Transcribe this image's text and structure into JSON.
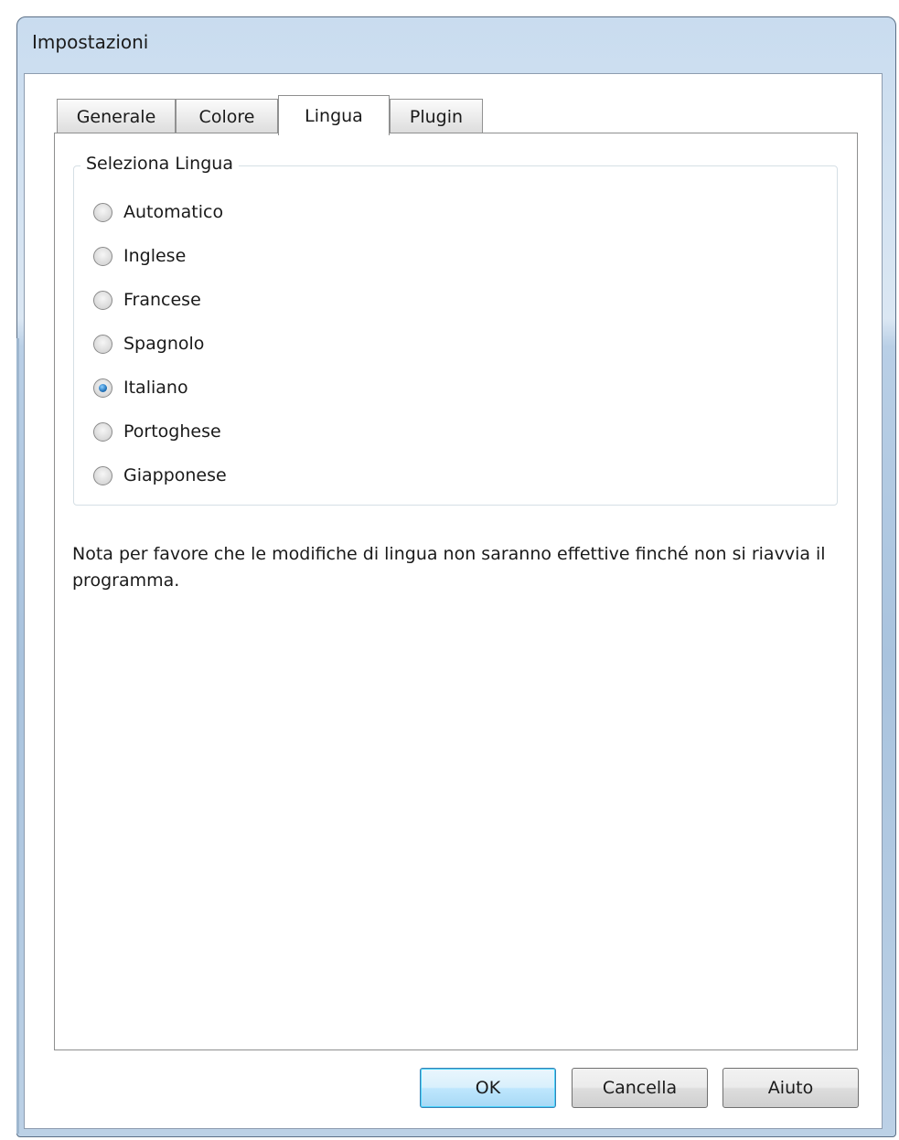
{
  "window": {
    "title": "Impostazioni"
  },
  "tabs": [
    {
      "label": "Generale",
      "active": false
    },
    {
      "label": "Colore",
      "active": false
    },
    {
      "label": "Lingua",
      "active": true
    },
    {
      "label": "Plugin",
      "active": false
    }
  ],
  "language_group": {
    "legend": "Seleziona Lingua",
    "options": [
      {
        "label": "Automatico",
        "checked": false
      },
      {
        "label": "Inglese",
        "checked": false
      },
      {
        "label": "Francese",
        "checked": false
      },
      {
        "label": "Spagnolo",
        "checked": false
      },
      {
        "label": "Italiano",
        "checked": true
      },
      {
        "label": "Portoghese",
        "checked": false
      },
      {
        "label": "Giapponese",
        "checked": false
      }
    ]
  },
  "note": "Nota per favore che le modifiche di lingua non saranno effettive finché non si riavvia il programma.",
  "buttons": {
    "ok": "OK",
    "cancel": "Cancella",
    "help": "Aiuto"
  },
  "colors": {
    "selected_radio": "#2a7bc2",
    "default_button_border": "#3c7fb1"
  }
}
